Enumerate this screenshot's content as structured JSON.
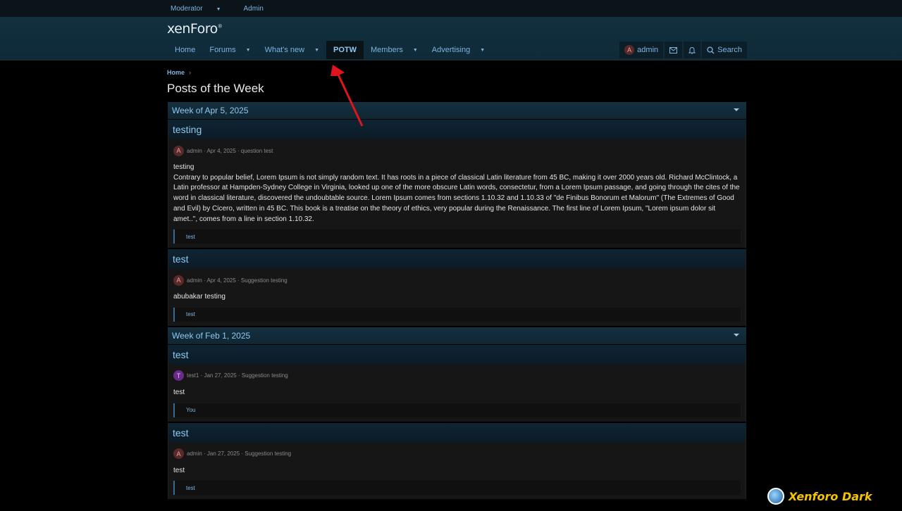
{
  "staffbar": {
    "moderator": "Moderator",
    "admin": "Admin"
  },
  "header": {
    "logo": "xenForo",
    "nav": [
      {
        "label": "Home",
        "dropdown": false
      },
      {
        "label": "Forums",
        "dropdown": true
      },
      {
        "label": "What's new",
        "dropdown": true
      },
      {
        "label": "POTW",
        "dropdown": false,
        "active": true
      },
      {
        "label": "Members",
        "dropdown": true
      },
      {
        "label": "Advertising",
        "dropdown": true
      }
    ],
    "user": {
      "initial": "A",
      "name": "admin"
    },
    "search_label": "Search"
  },
  "breadcrumb": {
    "home": "Home"
  },
  "page_title": "Posts of the Week",
  "weeks": [
    {
      "label": "Week of Apr 5, 2025",
      "posts": [
        {
          "title": "testing",
          "avatar": "A",
          "meta": "admin · Apr 4, 2025 · question test",
          "body_title": "testing",
          "body": "Contrary to popular belief, Lorem Ipsum is not simply random text. It has roots in a piece of classical Latin literature from 45 BC, making it over 2000 years old. Richard McClintock, a Latin professor at Hampden-Sydney College in Virginia, looked up one of the more obscure Latin words, consectetur, from a Lorem Ipsum passage, and going through the cites of the word in classical literature, discovered the undoubtable source. Lorem Ipsum comes from sections 1.10.32 and 1.10.33 of \"de Finibus Bonorum et Malorum\" (The Extremes of Good and Evil) by Cicero, written in 45 BC. This book is a treatise on the theory of ethics, very popular during the Renaissance. The first line of Lorem Ipsum, \"Lorem ipsum dolor sit amet..\", comes from a line in section 1.10.32.",
          "reply": "test"
        },
        {
          "title": "test",
          "avatar": "A",
          "meta": "admin · Apr 4, 2025 · Suggestion testing",
          "body_title": "abubakar testing",
          "body": "",
          "reply": "test"
        }
      ]
    },
    {
      "label": "Week of Feb 1, 2025",
      "posts": [
        {
          "title": "test",
          "avatar": "T",
          "meta": "test1 · Jan 27, 2025 · Suggestion testing",
          "body_title": "test",
          "body": "",
          "reply": "You"
        },
        {
          "title": "test",
          "avatar": "A",
          "meta": "admin · Jan 27, 2025 · Suggestion testing",
          "body_title": "test",
          "body": "",
          "reply": "test"
        }
      ]
    }
  ],
  "watermark": "Xenforo Dark",
  "colors": {
    "accent": "#7db4e0",
    "annotation_arrow": "#e0141e"
  }
}
